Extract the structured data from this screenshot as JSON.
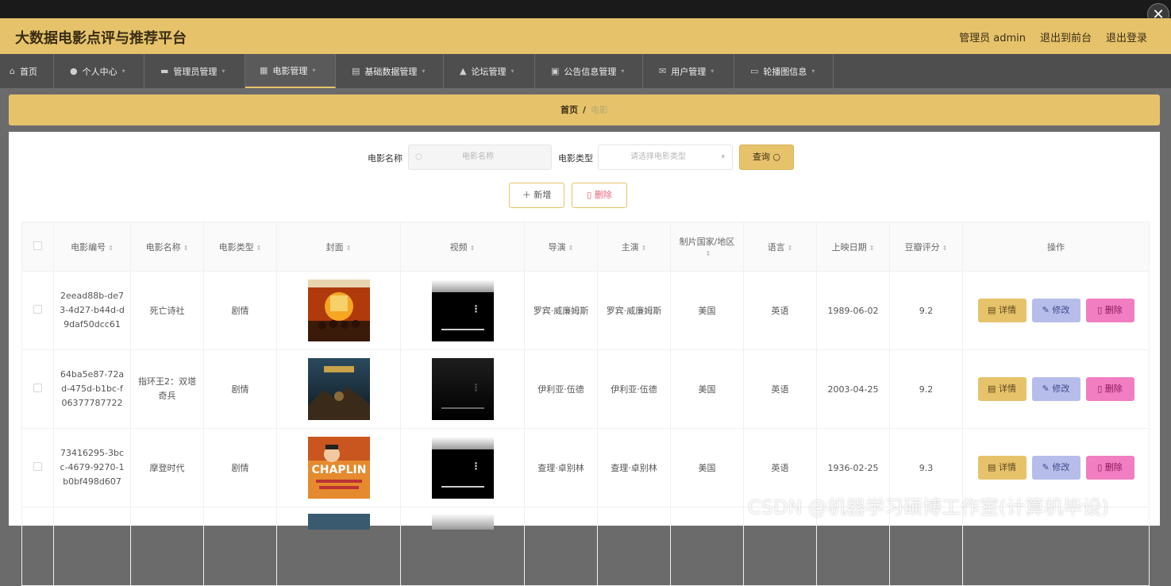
{
  "app": {
    "title": "大数据电影点评与推荐平台",
    "user_label": "管理员 admin",
    "back_to_front": "退出到前台",
    "logout": "退出登录",
    "close_glyph": "✕"
  },
  "nav": {
    "items": [
      {
        "label": "首页",
        "icon": "home-icon"
      },
      {
        "label": "个人中心",
        "icon": "user-icon"
      },
      {
        "label": "管理员管理",
        "icon": "admin-icon"
      },
      {
        "label": "电影管理",
        "icon": "grid-icon",
        "active": true
      },
      {
        "label": "基础数据管理",
        "icon": "database-icon"
      },
      {
        "label": "论坛管理",
        "icon": "forum-icon"
      },
      {
        "label": "公告信息管理",
        "icon": "notice-icon"
      },
      {
        "label": "用户管理",
        "icon": "mail-icon"
      },
      {
        "label": "轮播图信息",
        "icon": "chat-icon"
      }
    ]
  },
  "breadcrumb": {
    "home": "首页",
    "sep": "/",
    "current": "电影"
  },
  "search": {
    "name_label": "电影名称",
    "name_placeholder": "电影名称",
    "type_label": "电影类型",
    "type_placeholder": "请选择电影类型",
    "query_label": "查询"
  },
  "actions": {
    "add": "新增",
    "delete": "删除"
  },
  "table": {
    "headers": [
      "电影编号",
      "电影名称",
      "电影类型",
      "封面",
      "视频",
      "导演",
      "主演",
      "制片国家/地区",
      "语言",
      "上映日期",
      "豆瓣评分",
      "操作"
    ],
    "rows": [
      {
        "id": "2eead88b-de73-4d27-b44d-d9daf50dcc61",
        "name": "死亡诗社",
        "type": "剧情",
        "director": "罗宾·威廉姆斯",
        "star": "罗宾·威廉姆斯",
        "country": "美国",
        "language": "英语",
        "date": "1989-06-02",
        "score": "9.2"
      },
      {
        "id": "64ba5e87-72ad-475d-b1bc-f06377787722",
        "name": "指环王2：双塔奇兵",
        "type": "剧情",
        "director": "伊利亚·伍德",
        "star": "伊利亚·伍德",
        "country": "美国",
        "language": "英语",
        "date": "2003-04-25",
        "score": "9.2"
      },
      {
        "id": "73416295-3bcc-4679-9270-1b0bf498d607",
        "name": "摩登时代",
        "type": "剧情",
        "director": "查理·卓别林",
        "star": "查理·卓别林",
        "country": "美国",
        "language": "英语",
        "date": "1936-02-25",
        "score": "9.3"
      }
    ],
    "op_detail": "详情",
    "op_edit": "修改",
    "op_delete": "删除",
    "cover3_text": "CHAPLIN"
  },
  "watermark": "CSDN @机器学习硕博工作室(计算机毕设)"
}
